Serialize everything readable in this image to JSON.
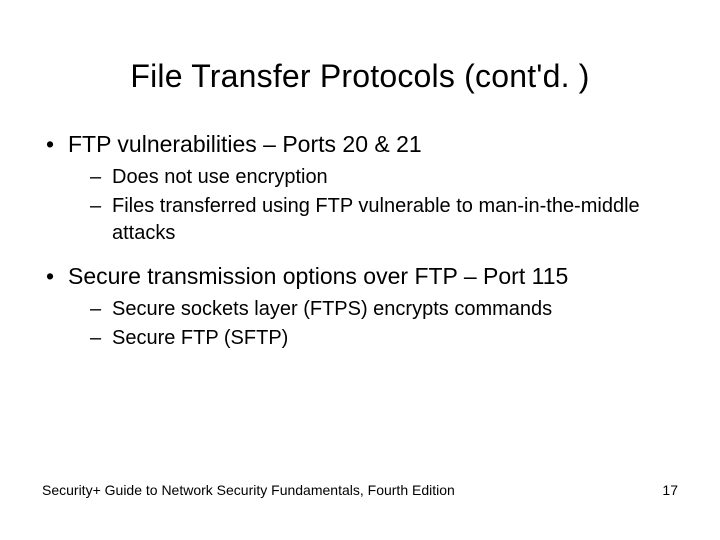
{
  "title": "File Transfer Protocols (cont'd. )",
  "bullets": [
    {
      "text": "FTP vulnerabilities – Ports 20 & 21",
      "sub": [
        "Does not use encryption",
        "Files transferred using FTP vulnerable to man-in-the-middle attacks"
      ]
    },
    {
      "text": "Secure transmission options over FTP – Port 115",
      "sub": [
        "Secure sockets layer (FTPS) encrypts commands",
        "Secure FTP (SFTP)"
      ]
    }
  ],
  "footer": {
    "source": "Security+ Guide to Network Security Fundamentals, Fourth Edition",
    "page": "17"
  }
}
